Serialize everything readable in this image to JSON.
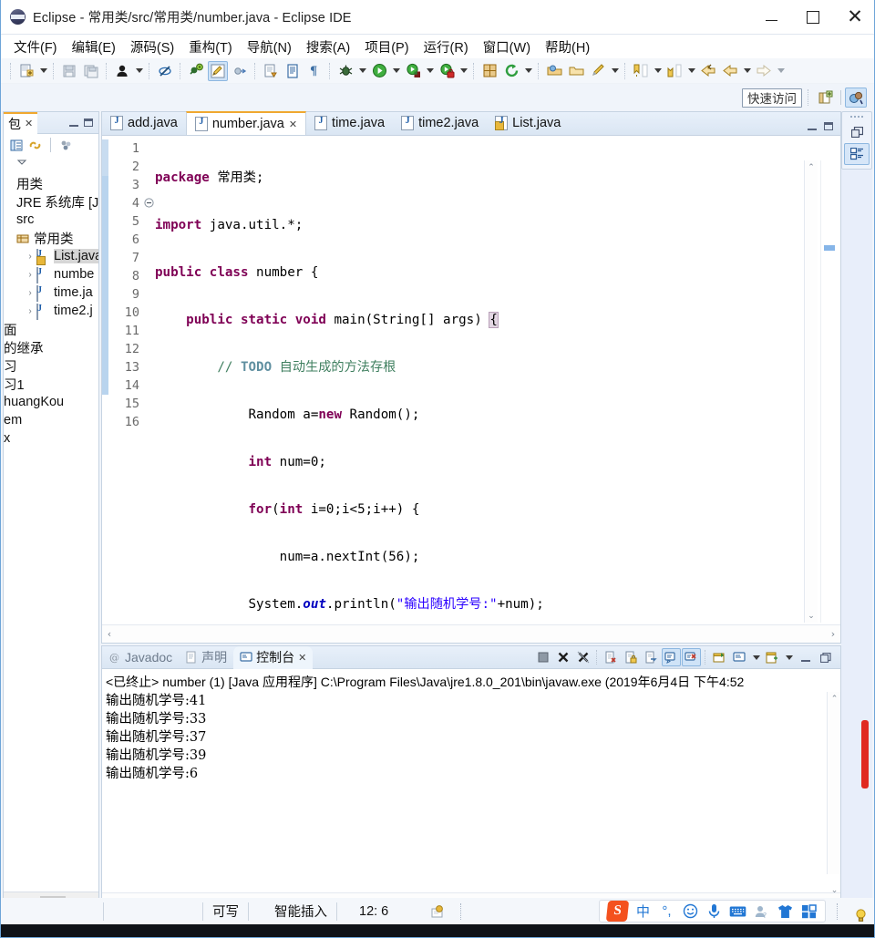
{
  "window": {
    "title": "Eclipse - 常用类/src/常用类/number.java - Eclipse IDE",
    "app_icon": "eclipse-icon",
    "minimize": "−",
    "maximize": "□",
    "close": "✕"
  },
  "menubar": {
    "items": [
      {
        "label": "文件(F)",
        "mnemonic": "F"
      },
      {
        "label": "编辑(E)",
        "mnemonic": "E"
      },
      {
        "label": "源码(S)",
        "mnemonic": "S"
      },
      {
        "label": "重构(T)",
        "mnemonic": "T"
      },
      {
        "label": "导航(N)",
        "mnemonic": "N"
      },
      {
        "label": "搜索(A)",
        "mnemonic": "A"
      },
      {
        "label": "项目(P)",
        "mnemonic": "P"
      },
      {
        "label": "运行(R)",
        "mnemonic": "R"
      },
      {
        "label": "窗口(W)",
        "mnemonic": "W"
      },
      {
        "label": "帮助(H)",
        "mnemonic": "H"
      }
    ]
  },
  "toolbar": {
    "buttons": [
      "new-wizard-icon",
      "new-dropdown-arrow",
      "save-icon",
      "save-all-icon",
      "person-icon",
      "person-dropdown-arrow",
      "skip-breakpoints-icon",
      "debug-last-icon",
      "toggle-highlight-icon",
      "external-tools-icon",
      "open-type-icon",
      "open-task-icon",
      "pilcrow-icon",
      "debug-icon",
      "debug-dropdown-arrow",
      "run-icon",
      "run-dropdown-arrow",
      "run-config-icon",
      "run-config-dropdown-arrow",
      "coverage-icon",
      "coverage-dropdown-arrow",
      "new-java-project-icon",
      "refresh-icon",
      "refresh-dropdown-arrow",
      "open-package-icon",
      "open-folder-icon",
      "search-icon",
      "search-dropdown-arrow",
      "next-annotation-icon",
      "next-dropdown-arrow",
      "previous-annotation-icon",
      "prev-dropdown-arrow",
      "back-icon",
      "forward-icon",
      "forward-dropdown-arrow",
      "next-edit-icon",
      "next-edit-dropdown-arrow"
    ]
  },
  "quick_access": {
    "placeholder": "快速访问",
    "value": "快速访问",
    "open_perspective_icon": "open-perspective-icon",
    "java_perspective_icon": "java-perspective-icon"
  },
  "package_explorer": {
    "tab_label": "包",
    "tab_close": "✕",
    "toolbar_icons": [
      "collapse-all-icon",
      "link-with-editor-icon",
      "view-menu-icon",
      "view-chevron-icon"
    ],
    "minimize_icon": "minimize-icon",
    "maximize_icon": "maximize-icon",
    "tree": [
      {
        "label": "用类",
        "depth": 0,
        "arrow": "",
        "icon": "project-icon"
      },
      {
        "label": "JRE 系统库 [Ja",
        "depth": 0,
        "arrow": "",
        "icon": "library-icon"
      },
      {
        "label": "src",
        "depth": 0,
        "arrow": "",
        "icon": "source-folder-icon"
      },
      {
        "label": "常用类",
        "depth": 1,
        "arrow": "",
        "icon": "package-icon"
      },
      {
        "label": "List.java",
        "depth": 2,
        "arrow": "›",
        "icon": "java-file-lock-icon",
        "selected": true
      },
      {
        "label": "numbe",
        "depth": 2,
        "arrow": "›",
        "icon": "java-file-icon"
      },
      {
        "label": "time.ja",
        "depth": 2,
        "arrow": "›",
        "icon": "java-file-icon"
      },
      {
        "label": "time2.j",
        "depth": 2,
        "arrow": "›",
        "icon": "java-file-icon"
      },
      {
        "label": "面",
        "depth": 0,
        "arrow": "",
        "icon": "project-icon"
      },
      {
        "label": "的继承",
        "depth": 0,
        "arrow": "",
        "icon": "project-icon"
      },
      {
        "label": "习",
        "depth": 0,
        "arrow": "",
        "icon": "project-icon"
      },
      {
        "label": "习1",
        "depth": 0,
        "arrow": "",
        "icon": "project-icon"
      },
      {
        "label": "huangKou",
        "depth": 0,
        "arrow": "",
        "icon": "project-icon"
      },
      {
        "label": "em",
        "depth": 0,
        "arrow": "",
        "icon": "project-icon"
      },
      {
        "label": "x",
        "depth": 0,
        "arrow": "",
        "icon": "project-icon"
      }
    ],
    "scroll_left": "‹",
    "scroll_right": "›"
  },
  "editor": {
    "tabs": [
      {
        "label": "add.java",
        "active": false,
        "icon": "java-file-icon",
        "closable": false
      },
      {
        "label": "number.java",
        "active": true,
        "icon": "java-file-icon",
        "closable": true,
        "close": "✕"
      },
      {
        "label": "time.java",
        "active": false,
        "icon": "java-file-icon",
        "closable": false
      },
      {
        "label": "time2.java",
        "active": false,
        "icon": "java-file-icon",
        "closable": false
      },
      {
        "label": "List.java",
        "active": false,
        "icon": "java-file-lock-icon",
        "closable": false
      }
    ],
    "minimize_icon": "minimize-icon",
    "maximize_icon": "maximize-icon",
    "line_numbers": [
      "1",
      "2",
      "3",
      "4",
      "5",
      "6",
      "7",
      "8",
      "9",
      "10",
      "11",
      "12",
      "13",
      "14",
      "15",
      "16"
    ],
    "current_line": 12,
    "fold_marker_line": 4,
    "lines": [
      {
        "n": 1,
        "tokens": [
          {
            "t": "package ",
            "c": "kw"
          },
          {
            "t": "常用类;",
            "c": ""
          }
        ]
      },
      {
        "n": 2,
        "tokens": [
          {
            "t": "import ",
            "c": "kw"
          },
          {
            "t": "java.util.*;",
            "c": ""
          }
        ]
      },
      {
        "n": 3,
        "tokens": [
          {
            "t": "public class ",
            "c": "kw"
          },
          {
            "t": "number {",
            "c": ""
          }
        ]
      },
      {
        "n": 4,
        "tokens": [
          {
            "t": "    ",
            "c": ""
          },
          {
            "t": "public static void ",
            "c": "kw"
          },
          {
            "t": "main(String[] args) ",
            "c": ""
          },
          {
            "t": "{",
            "c": "brkt"
          }
        ]
      },
      {
        "n": 5,
        "tokens": [
          {
            "t": "        ",
            "c": ""
          },
          {
            "t": "// ",
            "c": "cmt"
          },
          {
            "t": "TODO",
            "c": "todo"
          },
          {
            "t": " 自动生成的方法存根",
            "c": "cmt"
          }
        ]
      },
      {
        "n": 6,
        "tokens": [
          {
            "t": "            Random a=",
            "c": ""
          },
          {
            "t": "new ",
            "c": "kw"
          },
          {
            "t": "Random();",
            "c": ""
          }
        ]
      },
      {
        "n": 7,
        "tokens": [
          {
            "t": "            ",
            "c": ""
          },
          {
            "t": "int ",
            "c": "kw"
          },
          {
            "t": "num=0;",
            "c": ""
          }
        ]
      },
      {
        "n": 8,
        "tokens": [
          {
            "t": "            ",
            "c": ""
          },
          {
            "t": "for",
            "c": "kw"
          },
          {
            "t": "(",
            "c": ""
          },
          {
            "t": "int ",
            "c": "kw"
          },
          {
            "t": "i=0;i<5;i++) {",
            "c": ""
          }
        ]
      },
      {
        "n": 9,
        "tokens": [
          {
            "t": "                num=a.nextInt(56);",
            "c": ""
          }
        ]
      },
      {
        "n": 10,
        "tokens": [
          {
            "t": "            System.",
            "c": ""
          },
          {
            "t": "out",
            "c": "fld"
          },
          {
            "t": ".println(",
            "c": ""
          },
          {
            "t": "\"输出随机学号:\"",
            "c": "str"
          },
          {
            "t": "+num);",
            "c": ""
          }
        ]
      },
      {
        "n": 11,
        "tokens": [
          {
            "t": "            }",
            "c": ""
          }
        ]
      },
      {
        "n": 12,
        "tokens": [
          {
            "t": "    }",
            "c": ""
          }
        ]
      },
      {
        "n": 13,
        "tokens": [
          {
            "t": "    }",
            "c": ""
          }
        ]
      },
      {
        "n": 14,
        "tokens": [
          {
            "t": "",
            "c": ""
          }
        ]
      },
      {
        "n": 15,
        "tokens": [
          {
            "t": "",
            "c": ""
          }
        ]
      },
      {
        "n": 16,
        "tokens": [
          {
            "t": "",
            "c": ""
          }
        ]
      }
    ],
    "scroll_up": "⌃",
    "scroll_down": "⌄",
    "scroll_left": "‹",
    "scroll_right": "›"
  },
  "console_panel": {
    "tabs": [
      {
        "label": "Javadoc",
        "icon": "javadoc-icon",
        "active": false
      },
      {
        "label": "声明",
        "icon": "declaration-icon",
        "active": false
      },
      {
        "label": "控制台",
        "icon": "console-icon",
        "active": true,
        "close": "✕"
      }
    ],
    "toolbar_icons": [
      "terminate-all-icon",
      "terminate-icon",
      "remove-launch-icon",
      "clear-console-icon",
      "scroll-lock-icon",
      "word-wrap-icon",
      "show-console-on-output-icon",
      "show-console-on-error-icon",
      "pin-console-icon",
      "display-selected-console-icon",
      "display-dropdown-arrow",
      "open-console-icon",
      "open-console-dropdown-arrow",
      "minimize-icon",
      "maximize-icon"
    ],
    "header": "<已终止> number  (1)  [Java 应用程序] C:\\Program Files\\Java\\jre1.8.0_201\\bin\\javaw.exe  (2019年6月4日 下午4:52",
    "output_lines": [
      "输出随机学号:41",
      "输出随机学号:33",
      "输出随机学号:37",
      "输出随机学号:39",
      "输出随机学号:6"
    ],
    "scroll_up": "⌃",
    "scroll_down": "⌄",
    "scroll_left": "‹",
    "scroll_right": "›"
  },
  "right_toolbar": {
    "restore_icon": "restore-icon",
    "outline_icon": "outline-icon"
  },
  "statusbar": {
    "writable": "可写",
    "insert_mode": "智能插入",
    "position": "12: 6",
    "build_icon": "build-indicator-icon"
  },
  "ime": {
    "logo": "S",
    "logo_name": "sogou-logo-icon",
    "buttons": [
      {
        "name": "chinese-mode-icon",
        "glyph": "中"
      },
      {
        "name": "punctuation-icon",
        "glyph": "°,"
      },
      {
        "name": "emoji-icon",
        "glyph": "☺"
      },
      {
        "name": "voice-input-icon",
        "glyph": "🎤"
      },
      {
        "name": "soft-keyboard-icon",
        "glyph": "⌨"
      },
      {
        "name": "user-icon",
        "glyph": "👤"
      },
      {
        "name": "skin-icon",
        "glyph": "👕"
      },
      {
        "name": "toolbox-icon",
        "glyph": "▦"
      }
    ],
    "tray_bulb_icon": "tip-bulb-icon"
  },
  "colors": {
    "accent": "#f0a830",
    "keyword": "#7f0055",
    "string": "#2a00ff",
    "comment": "#3f7f5f",
    "field": "#0000c0",
    "selection": "#eaf3fb",
    "tab_active_bg": "#ffffff",
    "panel_border": "#c6d3e2",
    "error_mark": "#e02b20"
  }
}
